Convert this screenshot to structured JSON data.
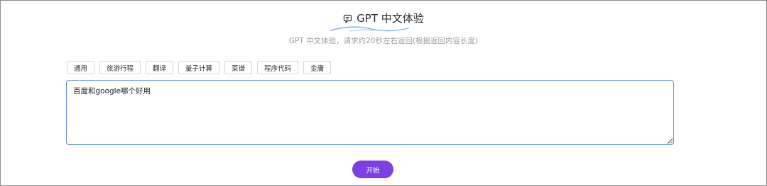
{
  "header": {
    "title": "GPT 中文体验",
    "icon": "chat-bubble-icon",
    "subtitle": "GPT 中文体验，请求约20秒左右返回(根据返回内容长度)"
  },
  "chips": [
    {
      "label": "通用"
    },
    {
      "label": "旅游行程"
    },
    {
      "label": "翻译"
    },
    {
      "label": "量子计算"
    },
    {
      "label": "菜谱"
    },
    {
      "label": "程序代码"
    },
    {
      "label": "金庸"
    }
  ],
  "prompt": {
    "value": "百度和google哪个好用"
  },
  "actions": {
    "start_label": "开始"
  },
  "colors": {
    "accent": "#7b3fe4",
    "input_border": "#5b8def",
    "underline": "#7ab2f0"
  }
}
